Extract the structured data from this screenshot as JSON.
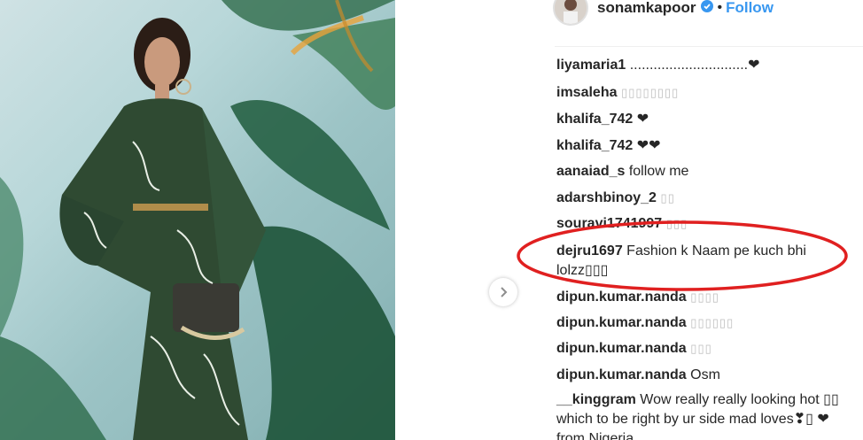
{
  "header": {
    "username": "sonamkapoor",
    "separator": "•",
    "follow_label": "Follow"
  },
  "comments": [
    {
      "user": "liyamaria1",
      "text": " ..............................❤"
    },
    {
      "user": "imsaleha",
      "text": " ▯▯▯▯▯▯▯▯"
    },
    {
      "user": "khalifa_742",
      "text": " ❤"
    },
    {
      "user": "khalifa_742",
      "text": " ❤❤"
    },
    {
      "user": "aanaiad_s",
      "text": " follow me"
    },
    {
      "user": "adarshbinoy_2",
      "text": " ▯▯"
    },
    {
      "user": "souravi1741997",
      "text": " ▯▯▯"
    },
    {
      "user": "dejru1697",
      "text": " Fashion k Naam pe kuch bhi lolzz▯▯▯"
    },
    {
      "user": "dipun.kumar.nanda",
      "text": " ▯▯▯▯"
    },
    {
      "user": "dipun.kumar.nanda",
      "text": " ▯▯▯▯▯▯"
    },
    {
      "user": "dipun.kumar.nanda",
      "text": " ▯▯▯"
    },
    {
      "user": "dipun.kumar.nanda",
      "text": " Osm"
    },
    {
      "user": "__kinggram",
      "text": " Wow really really looking hot ▯▯ which to be right by ur side mad loves❣▯ ❤ from Nigeria"
    }
  ],
  "colors": {
    "follow": "#3897f0",
    "verified": "#3897f0",
    "annotation": "#e02020"
  },
  "icons": {
    "verified": "verified-badge-icon",
    "next": "chevron-right-icon"
  }
}
